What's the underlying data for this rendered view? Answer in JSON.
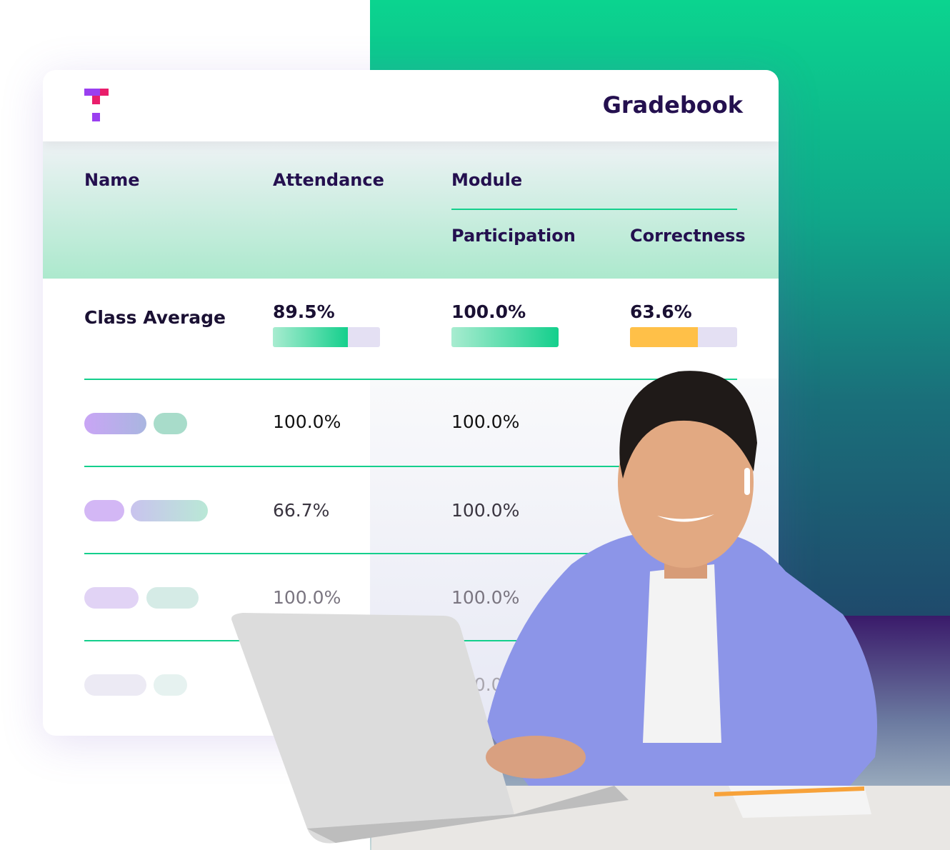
{
  "header": {
    "title": "Gradebook",
    "logo": "teachable-t-logo"
  },
  "columns": {
    "name": "Name",
    "attendance": "Attendance",
    "module": "Module",
    "participation": "Participation",
    "correctness": "Correctness"
  },
  "class_average": {
    "label": "Class Average",
    "attendance": "89.5%",
    "attendance_fraction": 0.895,
    "participation": "100.0%",
    "participation_fraction": 1.0,
    "correctness": "63.6%",
    "correctness_fraction": 0.636
  },
  "rows": [
    {
      "attendance": "100.0%",
      "participation": "100.0%"
    },
    {
      "attendance": "66.7%",
      "participation": "100.0%"
    },
    {
      "attendance": "100.0%",
      "participation": "100.0%"
    },
    {
      "attendance": "",
      "participation": "100.0%"
    }
  ],
  "colors": {
    "accent_green": "#14cf8c",
    "title_purple": "#24104f",
    "bar_yellow": "#ffc048",
    "logo_purple": "#9a3ff0",
    "logo_pink": "#e91e6b"
  }
}
